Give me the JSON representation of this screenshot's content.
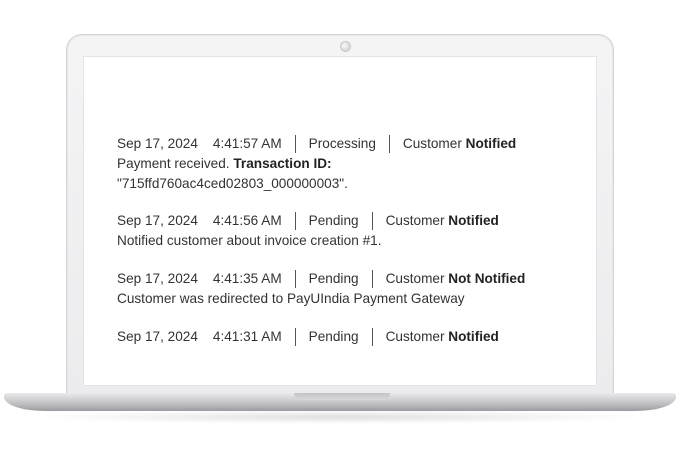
{
  "history": {
    "entries": [
      {
        "date": "Sep 17, 2024",
        "time": "4:41:57 AM",
        "status": "Processing",
        "customer_label": "Customer",
        "notify": "Notified",
        "comment_lines": [
          {
            "text": "Payment received.",
            "bold": "Transaction ID:"
          },
          {
            "text": "\"715ffd760ac4ced02803_000000003\"."
          }
        ]
      },
      {
        "date": "Sep 17, 2024",
        "time": "4:41:56 AM",
        "status": "Pending",
        "customer_label": "Customer",
        "notify": "Notified",
        "comment_lines": [
          {
            "text": "Notified customer about invoice creation #1."
          }
        ]
      },
      {
        "date": "Sep 17, 2024",
        "time": "4:41:35 AM",
        "status": "Pending",
        "customer_label": "Customer",
        "notify": "Not Notified",
        "comment_lines": [
          {
            "text": "Customer was redirected to PayUIndia Payment Gateway"
          }
        ]
      },
      {
        "date": "Sep 17, 2024",
        "time": "4:41:31 AM",
        "status": "Pending",
        "customer_label": "Customer",
        "notify": "Notified",
        "comment_lines": []
      }
    ]
  },
  "colors": {
    "text": "#333333",
    "separator": "#555555",
    "bezel": "#f0f0f1"
  }
}
